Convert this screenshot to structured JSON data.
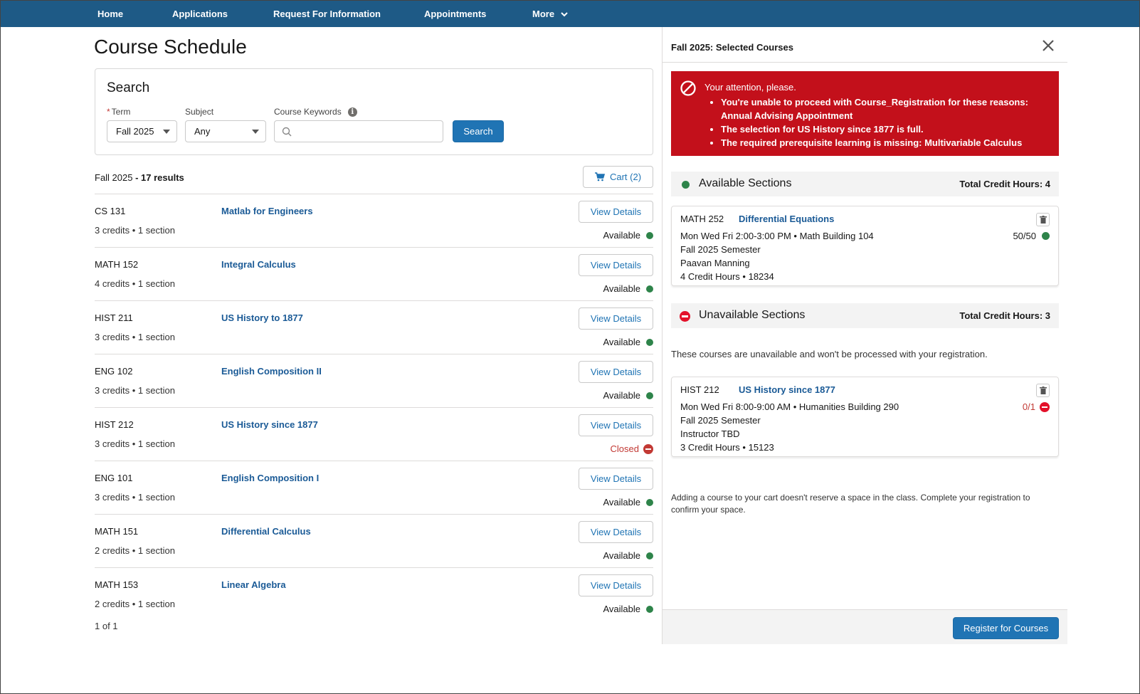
{
  "nav": {
    "items": [
      {
        "label": "Home"
      },
      {
        "label": "Applications"
      },
      {
        "label": "Request For Information"
      },
      {
        "label": "Appointments"
      },
      {
        "label": "More"
      }
    ]
  },
  "page": {
    "title": "Course Schedule"
  },
  "search": {
    "heading": "Search",
    "term_label": "Term",
    "term_value": "Fall 2025",
    "subject_label": "Subject",
    "subject_value": "Any",
    "keywords_label": "Course Keywords",
    "keywords_value": "",
    "button_label": "Search"
  },
  "results": {
    "term": "Fall 2025",
    "count_text": "17 results",
    "cart_label": "Cart (2)",
    "pager": "1 of 1",
    "view_details_label": "View Details",
    "courses": [
      {
        "code": "CS 131",
        "title": "Matlab for Engineers",
        "meta": "3 credits • 1 section",
        "status": "Available"
      },
      {
        "code": "MATH 152",
        "title": "Integral Calculus",
        "meta": "4 credits • 1 section",
        "status": "Available"
      },
      {
        "code": "HIST 211",
        "title": "US History to 1877",
        "meta": "3 credits • 1 section",
        "status": "Available"
      },
      {
        "code": "ENG 102",
        "title": "English Composition II",
        "meta": "3 credits • 1 section",
        "status": "Available"
      },
      {
        "code": "HIST 212",
        "title": "US History since 1877",
        "meta": "3 credits • 1 section",
        "status": "Closed"
      },
      {
        "code": "ENG 101",
        "title": "English Composition I",
        "meta": "3 credits • 1 section",
        "status": "Available"
      },
      {
        "code": "MATH 151",
        "title": "Differential Calculus",
        "meta": "2 credits • 1 section",
        "status": "Available"
      },
      {
        "code": "MATH 153",
        "title": "Linear Algebra",
        "meta": "2 credits • 1 section",
        "status": "Available"
      }
    ]
  },
  "panel": {
    "title": "Fall 2025: Selected Courses",
    "alert": {
      "title": "Your attention, please.",
      "reasons": [
        "You're unable to proceed with Course_Registration for these reasons: Annual Advising Appointment",
        "The selection for US History since 1877 is full.",
        "The required prerequisite learning is missing: Multivariable Calculus"
      ]
    },
    "available": {
      "title": "Available Sections",
      "credits": "Total Credit Hours: 4",
      "section": {
        "code": "MATH 252",
        "title": "Differential Equations",
        "schedule": "Mon Wed Fri 2:00-3:00 PM • Math Building 104",
        "seats": "50/50",
        "semester": "Fall 2025 Semester",
        "instructor": "Paavan Manning",
        "hours": "4 Credit Hours • 18234"
      }
    },
    "unavailable": {
      "title": "Unavailable Sections",
      "credits": "Total Credit Hours: 3",
      "note": "These courses are unavailable and won't be processed with your registration.",
      "section": {
        "code": "HIST 212",
        "title": "US History since 1877",
        "schedule": "Mon Wed Fri 8:00-9:00 AM • Humanities Building 290",
        "seats": "0/1",
        "semester": "Fall 2025 Semester",
        "instructor": "Instructor TBD",
        "hours": "3 Credit Hours • 15123"
      }
    },
    "cart_note": "Adding a course to your cart doesn't reserve a space in the class. Complete your registration to confirm your space.",
    "register_label": "Register for Courses"
  },
  "colors": {
    "nav_bg": "#1e5a86",
    "brand": "#2074b4",
    "link": "#1a5a96",
    "error": "#c3101b",
    "success": "#2e844a"
  }
}
